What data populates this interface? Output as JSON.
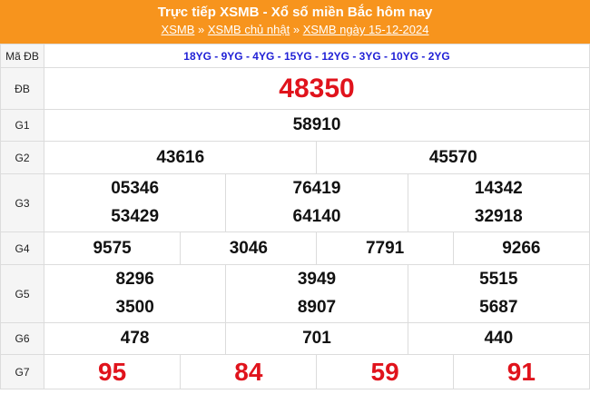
{
  "header": {
    "title": "Trực tiếp XSMB - Xổ số miền Bắc hôm nay",
    "crumbs": [
      "XSMB",
      "XSMB chủ nhật",
      "XSMB ngày 15-12-2024"
    ],
    "separator": "»"
  },
  "labels": {
    "ma_db": "Mã ĐB",
    "db": "ĐB",
    "g1": "G1",
    "g2": "G2",
    "g3": "G3",
    "g4": "G4",
    "g5": "G5",
    "g6": "G6",
    "g7": "G7"
  },
  "results": {
    "ma_db": "18YG - 9YG - 4YG - 15YG - 12YG - 3YG - 10YG - 2YG",
    "db": "48350",
    "g1": "58910",
    "g2": [
      "43616",
      "45570"
    ],
    "g3": [
      "05346",
      "76419",
      "14342",
      "53429",
      "64140",
      "32918"
    ],
    "g4": [
      "9575",
      "3046",
      "7791",
      "9266"
    ],
    "g5": [
      "8296",
      "3949",
      "5515",
      "3500",
      "8907",
      "5687"
    ],
    "g6": [
      "478",
      "701",
      "440"
    ],
    "g7": [
      "95",
      "84",
      "59",
      "91"
    ]
  },
  "colors": {
    "header_bg": "#f7941d",
    "special_red": "#e0131c",
    "code_blue": "#1f1fd6"
  }
}
